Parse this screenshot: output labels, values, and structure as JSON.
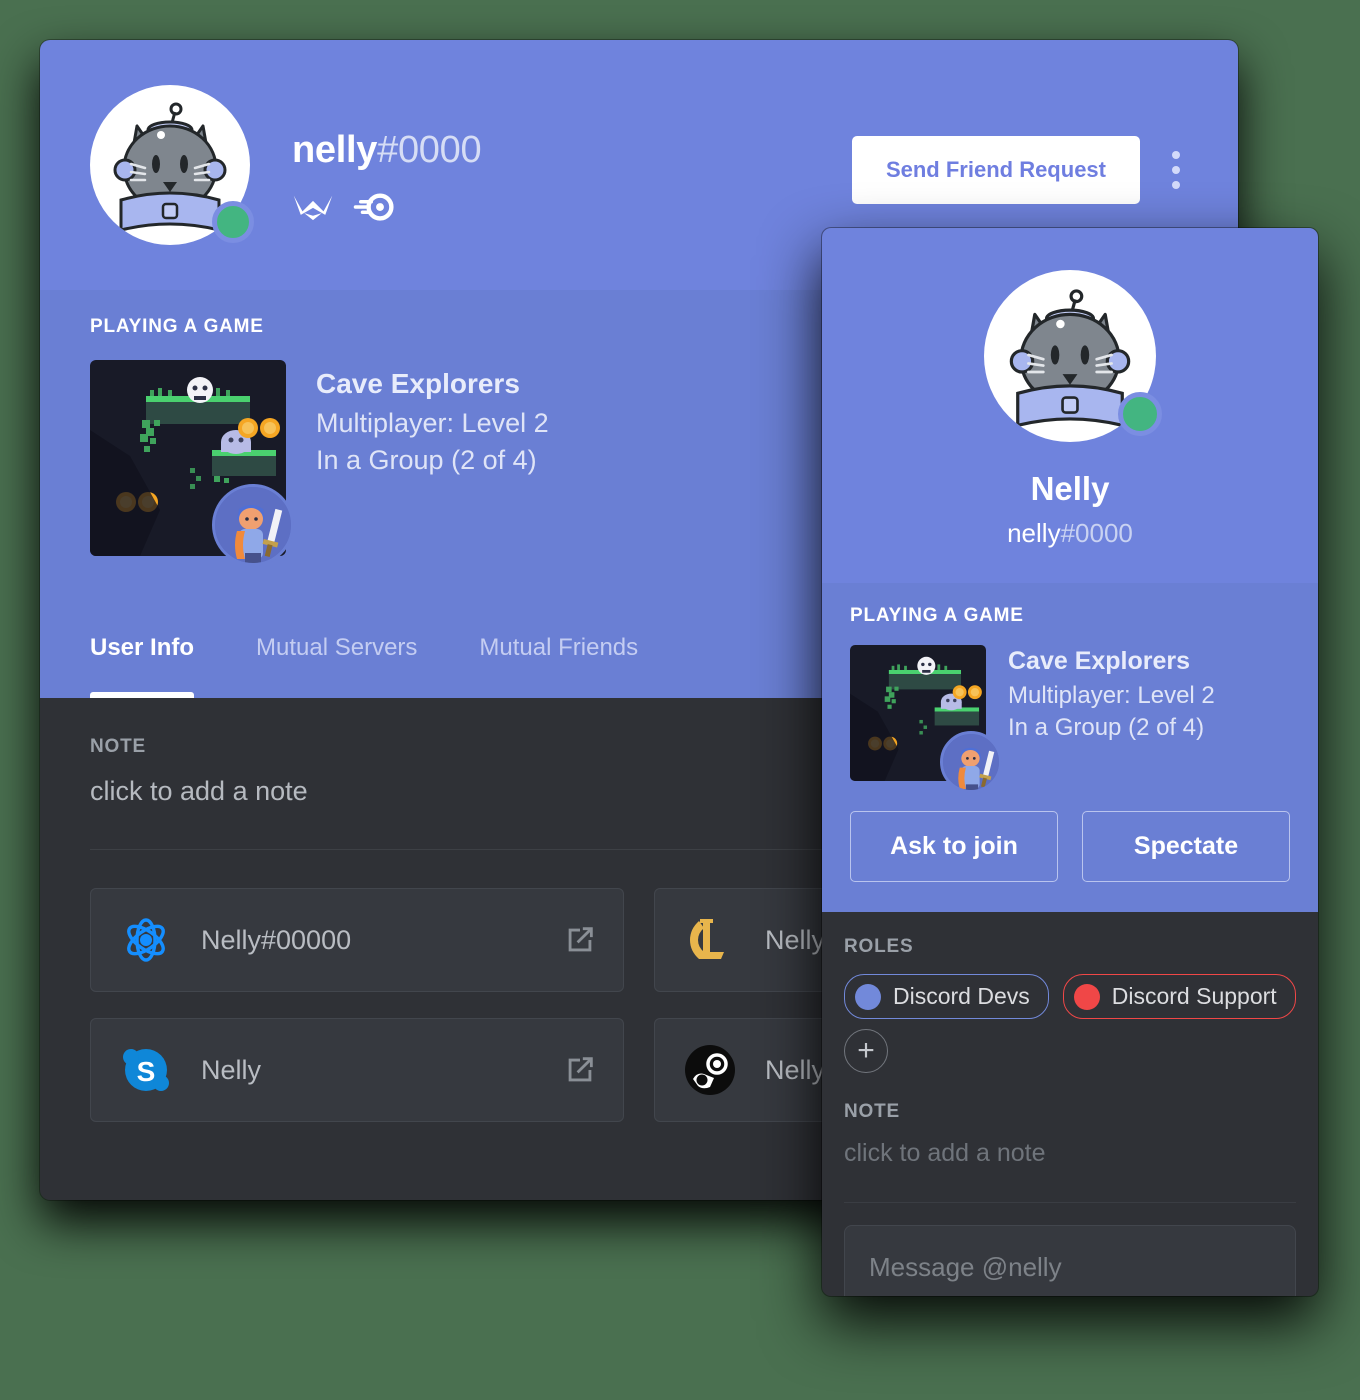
{
  "colors": {
    "page_background": "#4a7050",
    "banner_blurple": "#6f83dd",
    "section_blurple": "#6a7fd4",
    "body_dark": "#2f3136",
    "card_dark": "#36393f",
    "status_online_green": "#43b581",
    "role_devs": "#7289da",
    "role_support": "#f04747",
    "battlenet_blue": "#148eff",
    "lol_gold": "#e8b54c",
    "skype_blue": "#0f87d8",
    "steam_black": "#0c0c0c"
  },
  "profile": {
    "username": "nelly",
    "discriminator": "#0000",
    "status": "online",
    "badges": [
      {
        "name": "hypesquad-badge"
      },
      {
        "name": "nitro-boost-badge"
      }
    ],
    "friend_request_label": "Send Friend Request",
    "more_options_icon": "more-vertical-icon",
    "playing": {
      "section_label": "PLAYING A GAME",
      "game_title": "Cave Explorers",
      "line_1": "Multiplayer: Level 2",
      "line_2": "In a Group (2 of 4)"
    },
    "tabs": [
      {
        "label": "User Info",
        "active": true
      },
      {
        "label": "Mutual Servers",
        "active": false
      },
      {
        "label": "Mutual Friends",
        "active": false
      }
    ],
    "note": {
      "label": "NOTE",
      "placeholder": "click to add a note"
    },
    "connections": [
      {
        "service": "battlenet",
        "icon": "battlenet-icon",
        "name": "Nelly#00000",
        "action_icon": "external-link-icon"
      },
      {
        "service": "league-of-legends",
        "icon": "league-of-legends-icon",
        "name": "Nelly",
        "action_icon": "external-link-icon"
      },
      {
        "service": "skype",
        "icon": "skype-icon",
        "name": "Nelly",
        "action_icon": "external-link-icon"
      },
      {
        "service": "steam",
        "icon": "steam-icon",
        "name": "Nelly",
        "action_icon": "external-link-icon"
      }
    ]
  },
  "mini_profile": {
    "display_name": "Nelly",
    "username": "nelly",
    "discriminator": "#0000",
    "status": "online",
    "playing": {
      "section_label": "PLAYING A GAME",
      "game_title": "Cave Explorers",
      "line_1": "Multiplayer: Level 2",
      "line_2": "In a Group (2 of 4)",
      "ask_to_join_label": "Ask to join",
      "spectate_label": "Spectate"
    },
    "roles": {
      "label": "ROLES",
      "items": [
        {
          "name": "Discord Devs",
          "color": "#7289da"
        },
        {
          "name": "Discord Support",
          "color": "#f04747"
        }
      ],
      "add_label": "+"
    },
    "note": {
      "label": "NOTE",
      "placeholder": "click to add a note"
    },
    "message_input_placeholder": "Message @nelly"
  }
}
